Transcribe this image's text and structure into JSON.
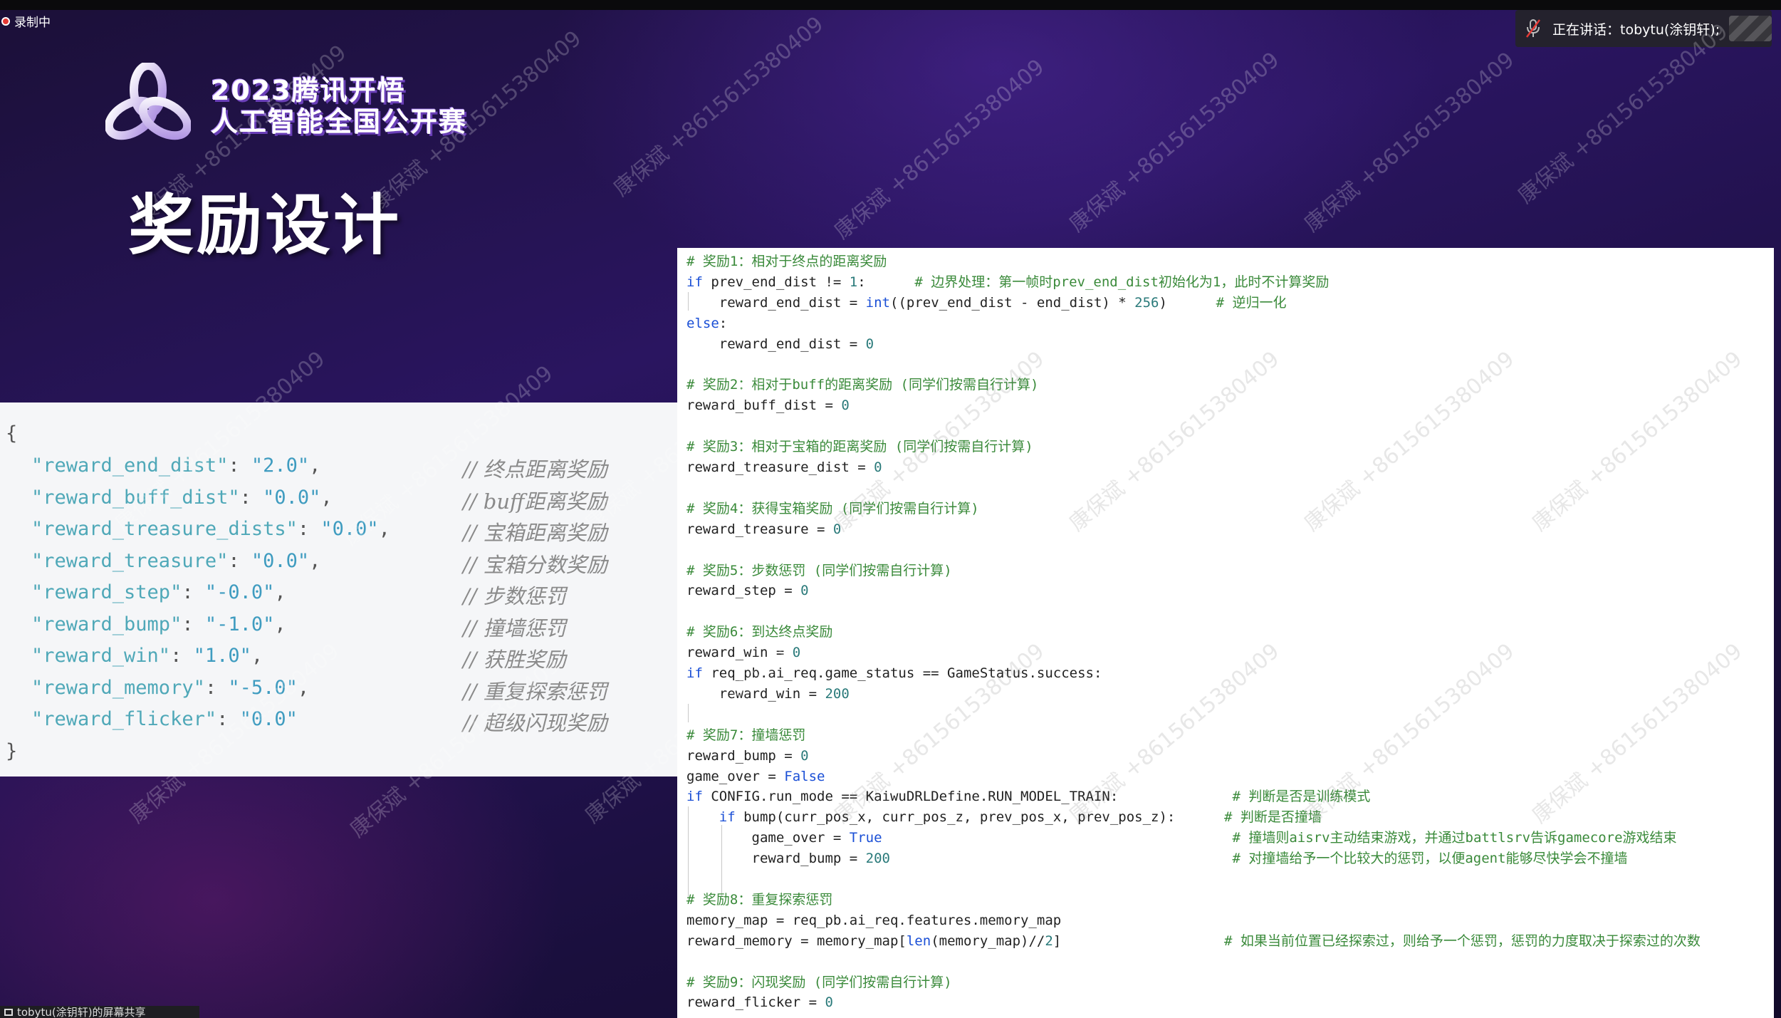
{
  "recording": {
    "label": "录制中"
  },
  "speaker": {
    "text": "正在讲话：tobytu(涂钥轩);"
  },
  "logo": {
    "line1": "2023腾讯开悟",
    "line2": "人工智能全国公开赛"
  },
  "slide_title": "奖励设计",
  "json_config": {
    "open_brace": "{",
    "close_brace": "}",
    "entries": [
      {
        "key": "\"reward_end_dist\"",
        "value": "\"2.0\"",
        "comment": "// 终点距离奖励"
      },
      {
        "key": "\"reward_buff_dist\"",
        "value": "\"0.0\"",
        "comment": "// buff距离奖励"
      },
      {
        "key": "\"reward_treasure_dists\"",
        "value": "\"0.0\"",
        "comment": "// 宝箱距离奖励"
      },
      {
        "key": "\"reward_treasure\"",
        "value": "\"0.0\"",
        "comment": "// 宝箱分数奖励"
      },
      {
        "key": "\"reward_step\"",
        "value": "\"-0.0\"",
        "comment": "// 步数惩罚"
      },
      {
        "key": "\"reward_bump\"",
        "value": "\"-1.0\"",
        "comment": "// 撞墙惩罚"
      },
      {
        "key": "\"reward_win\"",
        "value": "\"1.0\"",
        "comment": "// 获胜奖励"
      },
      {
        "key": "\"reward_memory\"",
        "value": "\"-5.0\"",
        "comment": "// 重复探索惩罚"
      },
      {
        "key": "\"reward_flicker\"",
        "value": "\"0.0\"",
        "comment": "// 超级闪现奖励"
      }
    ]
  },
  "code": {
    "lines": [
      "# 奖励1：相对于终点的距离奖励",
      "if prev_end_dist != 1:      # 边界处理：第一帧时prev_end_dist初始化为1，此时不计算奖励",
      "    reward_end_dist = int((prev_end_dist - end_dist) * 256)      # 逆归一化",
      "else:",
      "    reward_end_dist = 0",
      "",
      "# 奖励2：相对于buff的距离奖励 (同学们按需自行计算)",
      "reward_buff_dist = 0",
      "",
      "# 奖励3：相对于宝箱的距离奖励 (同学们按需自行计算)",
      "reward_treasure_dist = 0",
      "",
      "# 奖励4：获得宝箱奖励 (同学们按需自行计算)",
      "reward_treasure = 0",
      "",
      "# 奖励5：步数惩罚 (同学们按需自行计算)",
      "reward_step = 0",
      "",
      "# 奖励6：到达终点奖励",
      "reward_win = 0",
      "if req_pb.ai_req.game_status == GameStatus.success:",
      "    reward_win = 200",
      "",
      "# 奖励7：撞墙惩罚",
      "reward_bump = 0",
      "game_over = False",
      "if CONFIG.run_mode == KaiwuDRLDefine.RUN_MODEL_TRAIN:              # 判断是否是训练模式",
      "    if bump(curr_pos_x, curr_pos_z, prev_pos_x, prev_pos_z):      # 判断是否撞墙",
      "        game_over = True                                           # 撞墙则aisrv主动结束游戏，并通过battlsrv告诉gamecore游戏结束",
      "        reward_bump = 200                                          # 对撞墙给予一个比较大的惩罚，以便agent能够尽快学会不撞墙",
      "",
      "# 奖励8：重复探索惩罚",
      "memory_map = req_pb.ai_req.features.memory_map",
      "reward_memory = memory_map[len(memory_map)//2]                    # 如果当前位置已经探索过，则给予一个惩罚，惩罚的力度取决于探索过的次数",
      "",
      "# 奖励9：闪现奖励 (同学们按需自行计算)",
      "reward_flicker = 0"
    ]
  },
  "watermark": {
    "text": "康保斌 +8615615380409"
  },
  "bottom_tab": {
    "label": "tobytu(涂钥轩)的屏幕共享"
  },
  "colors": {
    "accent": "#6a3fb8",
    "code_comment": "#3a8a3a",
    "code_keyword": "#1a4fd6",
    "json_key": "#4fa8b8"
  }
}
